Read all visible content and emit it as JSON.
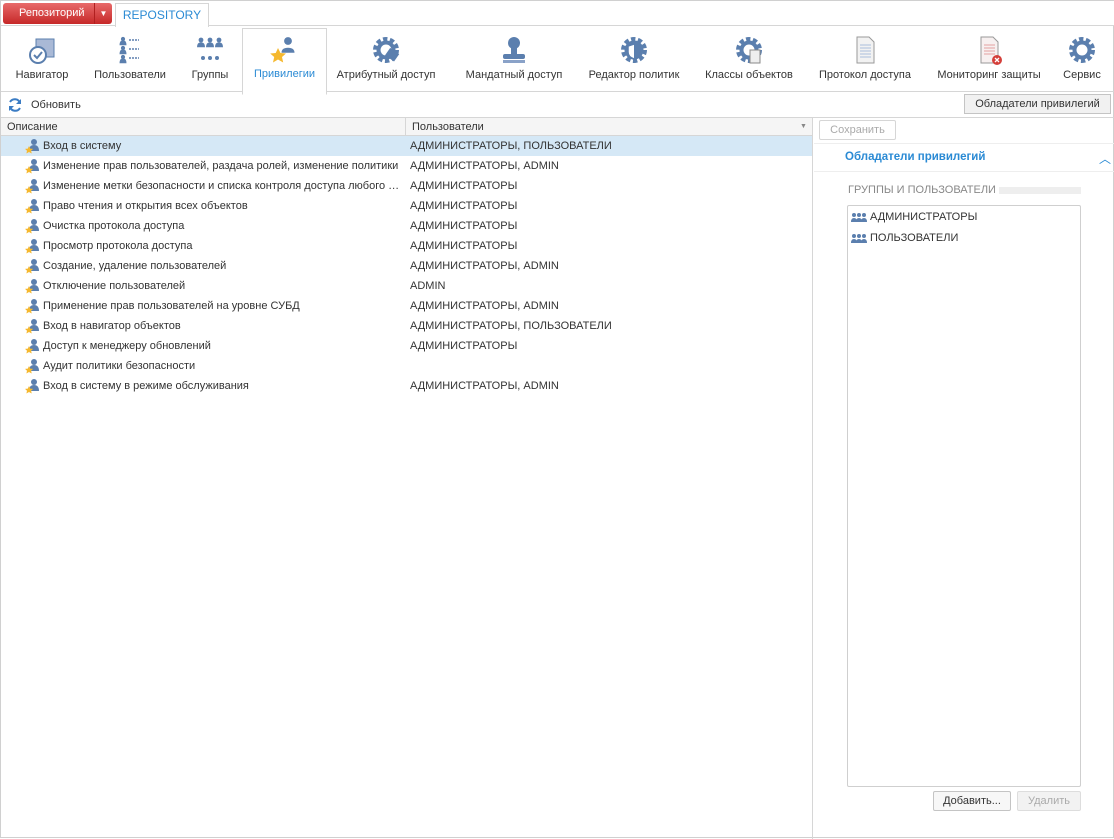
{
  "top": {
    "repo_button": "Репозиторий",
    "tab": "REPOSITORY"
  },
  "ribbon": [
    {
      "label": "Навигатор",
      "icon": "navigator-icon"
    },
    {
      "label": "Пользователи",
      "icon": "users-list-icon"
    },
    {
      "label": "Группы",
      "icon": "groups-icon"
    },
    {
      "label": "Привилегии",
      "icon": "privileges-icon",
      "selected": true
    },
    {
      "label": "Атрибутный доступ",
      "icon": "attribute-access-icon"
    },
    {
      "label": "Мандатный доступ",
      "icon": "stamp-icon"
    },
    {
      "label": "Редактор политик",
      "icon": "policy-shield-icon"
    },
    {
      "label": "Классы объектов",
      "icon": "object-classes-icon"
    },
    {
      "label": "Протокол доступа",
      "icon": "access-log-icon"
    },
    {
      "label": "Мониторинг защиты",
      "icon": "security-monitor-icon"
    },
    {
      "label": "Сервис",
      "icon": "gear-icon"
    }
  ],
  "toolbar": {
    "refresh": "Обновить",
    "holders_button": "Обладатели привилегий"
  },
  "grid": {
    "columns": [
      "Описание",
      "Пользователи"
    ],
    "rows": [
      {
        "desc": "Вход в систему",
        "users": "АДМИНИСТРАТОРЫ, ПОЛЬЗОВАТЕЛИ"
      },
      {
        "desc": "Изменение прав пользователей, раздача ролей, изменение политики",
        "users": "АДМИНИСТРАТОРЫ, ADMIN"
      },
      {
        "desc": "Изменение метки безопасности и списка контроля доступа любого объекта",
        "users": "АДМИНИСТРАТОРЫ"
      },
      {
        "desc": "Право чтения и открытия всех объектов",
        "users": "АДМИНИСТРАТОРЫ"
      },
      {
        "desc": "Очистка протокола доступа",
        "users": "АДМИНИСТРАТОРЫ"
      },
      {
        "desc": "Просмотр протокола доступа",
        "users": "АДМИНИСТРАТОРЫ"
      },
      {
        "desc": "Создание, удаление пользователей",
        "users": "АДМИНИСТРАТОРЫ, ADMIN"
      },
      {
        "desc": "Отключение пользователей",
        "users": "ADMIN"
      },
      {
        "desc": "Применение прав пользователей на уровне СУБД",
        "users": "АДМИНИСТРАТОРЫ, ADMIN"
      },
      {
        "desc": "Вход в навигатор объектов",
        "users": "АДМИНИСТРАТОРЫ, ПОЛЬЗОВАТЕЛИ"
      },
      {
        "desc": "Доступ к менеджеру обновлений",
        "users": "АДМИНИСТРАТОРЫ"
      },
      {
        "desc": "Аудит политики безопасности",
        "users": ""
      },
      {
        "desc": "Вход в систему в режиме обслуживания",
        "users": "АДМИНИСТРАТОРЫ, ADMIN"
      }
    ]
  },
  "panel": {
    "save": "Сохранить",
    "section_title": "Обладатели привилегий",
    "group_label": "ГРУППЫ И ПОЛЬЗОВАТЕЛИ",
    "holders": [
      "АДМИНИСТРАТОРЫ",
      "ПОЛЬЗОВАТЕЛИ"
    ],
    "add": "Добавить...",
    "delete": "Удалить"
  },
  "colors": {
    "accent": "#2a8ad4",
    "icon": "#5b7fae",
    "selected_row": "#d5e8f6",
    "repo_button": "#d63b3b",
    "star": "#f5b82e"
  }
}
